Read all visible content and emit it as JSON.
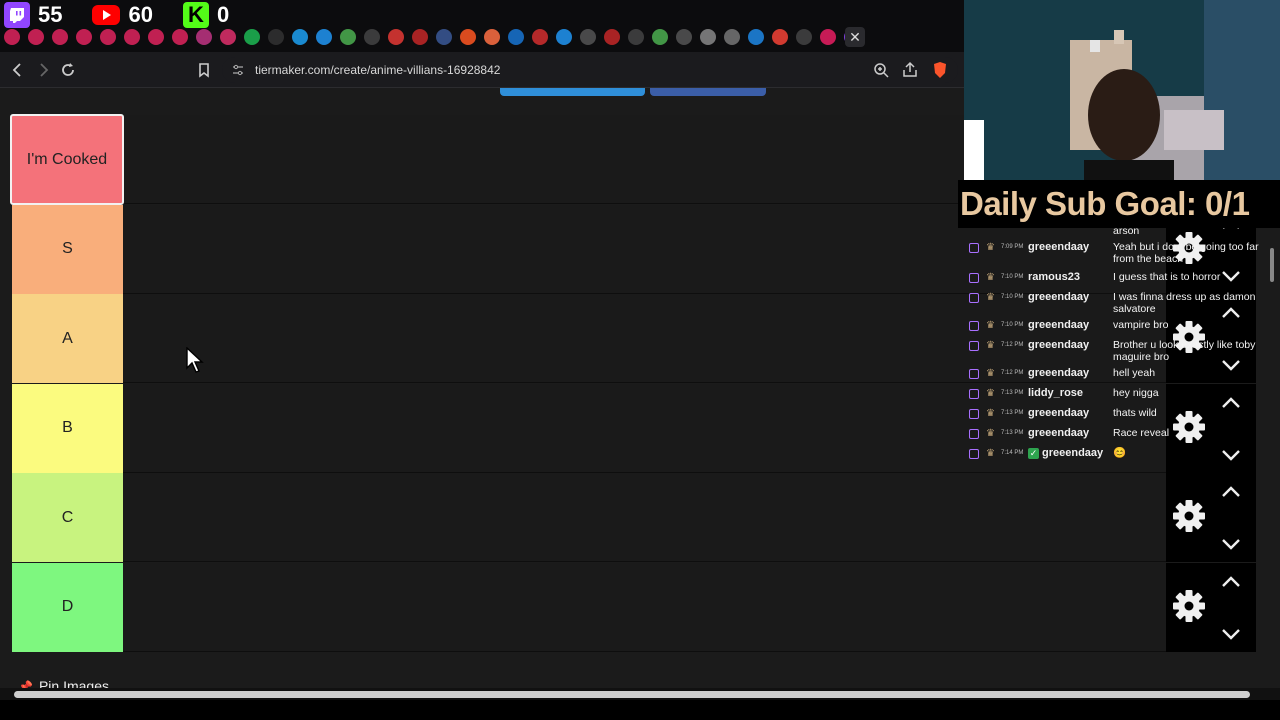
{
  "counters": [
    {
      "platform": "twitch",
      "icon": "twitch-icon",
      "value": "55",
      "color": "#9146ff"
    },
    {
      "platform": "youtube",
      "icon": "youtube-icon",
      "value": "60",
      "color": "#ff0000"
    },
    {
      "platform": "kick",
      "icon": "kick-icon",
      "value": "0",
      "color": "#53fc18"
    }
  ],
  "browser": {
    "url": "tiermaker.com/create/anime-villians-16928842",
    "close_tab": "✕"
  },
  "tiers": [
    {
      "label": "I'm Cooked",
      "color": "#f4727a",
      "selected": true
    },
    {
      "label": "S",
      "color": "#f9ae7b"
    },
    {
      "label": "A",
      "color": "#f8d285"
    },
    {
      "label": "B",
      "color": "#fbfb7f"
    },
    {
      "label": "C",
      "color": "#c8f37f"
    },
    {
      "label": "D",
      "color": "#7ef77f"
    }
  ],
  "pin_images": "Pin Images",
  "sub_goal": "Daily Sub Goal: 0/1",
  "chat": [
    {
      "time": "",
      "user": "",
      "text": "arson"
    },
    {
      "time": "7:09 PM",
      "user": "greeendaay",
      "text": "Yeah but i dont be going too far from the beach"
    },
    {
      "time": "7:10 PM",
      "user": "ramous23",
      "text": "I guess that is to horror"
    },
    {
      "time": "7:10 PM",
      "user": "greeendaay",
      "text": "I was finna dress up as damon salvatore"
    },
    {
      "time": "7:10 PM",
      "user": "greeendaay",
      "text": "vampire bro"
    },
    {
      "time": "7:12 PM",
      "user": "greeendaay",
      "text": "Brother u look exactly like toby maguire bro"
    },
    {
      "time": "7:12 PM",
      "user": "greeendaay",
      "text": "hell yeah"
    },
    {
      "time": "7:13 PM",
      "user": "liddy_rose",
      "text": "hey nigga"
    },
    {
      "time": "7:13 PM",
      "user": "greeendaay",
      "text": "thats wild"
    },
    {
      "time": "7:13 PM",
      "user": "greeendaay",
      "text": "Race reveal"
    },
    {
      "time": "7:14 PM",
      "user": "greeendaay",
      "text": "😊"
    }
  ]
}
